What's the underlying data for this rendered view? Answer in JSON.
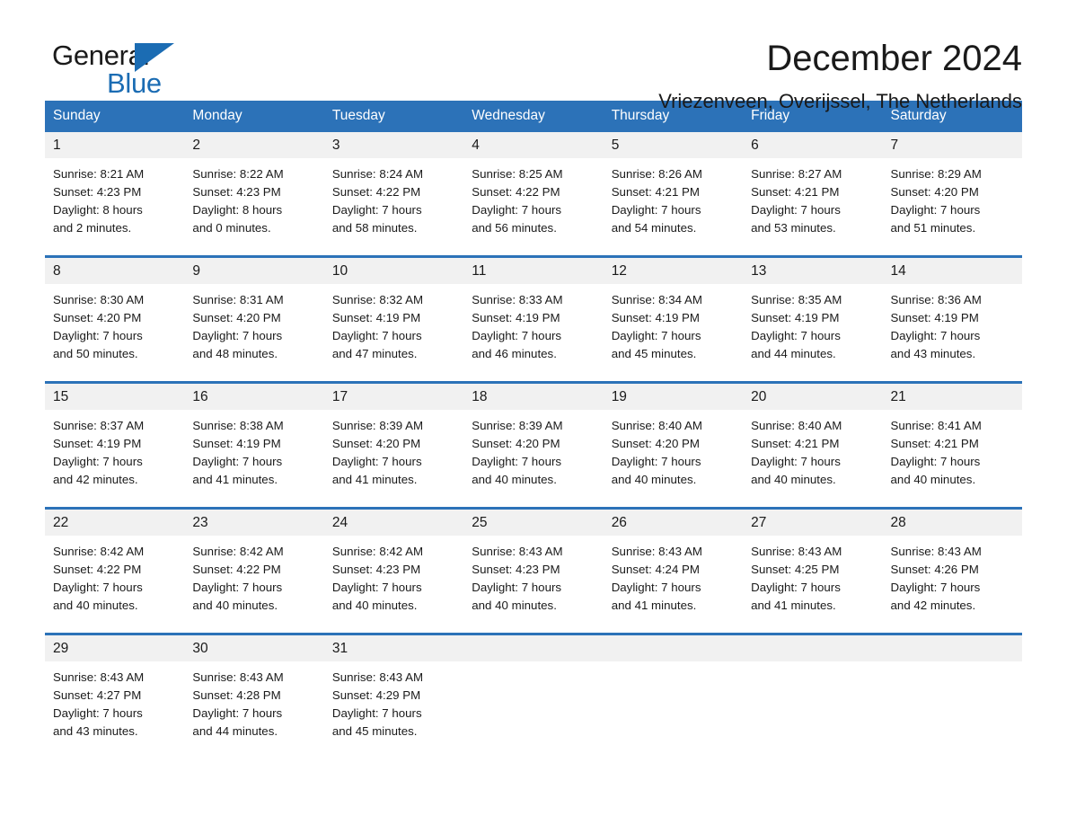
{
  "brand": {
    "name_part1": "General",
    "name_part2": "Blue",
    "flag_icon": "triangle-flag-icon",
    "accent_color": "#1b6cb3"
  },
  "header": {
    "title": "December 2024",
    "subtitle": "Vriezenveen, Overijssel, The Netherlands"
  },
  "theme": {
    "header_row_bg": "#2c72b8",
    "daynum_bg": "#f1f1f1",
    "week_divider": "#2c72b8",
    "text": "#1a1a1a"
  },
  "weekday_headers": [
    "Sunday",
    "Monday",
    "Tuesday",
    "Wednesday",
    "Thursday",
    "Friday",
    "Saturday"
  ],
  "weeks": [
    [
      {
        "day": "1",
        "sunrise": "Sunrise: 8:21 AM",
        "sunset": "Sunset: 4:23 PM",
        "daylight_line1": "Daylight: 8 hours",
        "daylight_line2": "and 2 minutes."
      },
      {
        "day": "2",
        "sunrise": "Sunrise: 8:22 AM",
        "sunset": "Sunset: 4:23 PM",
        "daylight_line1": "Daylight: 8 hours",
        "daylight_line2": "and 0 minutes."
      },
      {
        "day": "3",
        "sunrise": "Sunrise: 8:24 AM",
        "sunset": "Sunset: 4:22 PM",
        "daylight_line1": "Daylight: 7 hours",
        "daylight_line2": "and 58 minutes."
      },
      {
        "day": "4",
        "sunrise": "Sunrise: 8:25 AM",
        "sunset": "Sunset: 4:22 PM",
        "daylight_line1": "Daylight: 7 hours",
        "daylight_line2": "and 56 minutes."
      },
      {
        "day": "5",
        "sunrise": "Sunrise: 8:26 AM",
        "sunset": "Sunset: 4:21 PM",
        "daylight_line1": "Daylight: 7 hours",
        "daylight_line2": "and 54 minutes."
      },
      {
        "day": "6",
        "sunrise": "Sunrise: 8:27 AM",
        "sunset": "Sunset: 4:21 PM",
        "daylight_line1": "Daylight: 7 hours",
        "daylight_line2": "and 53 minutes."
      },
      {
        "day": "7",
        "sunrise": "Sunrise: 8:29 AM",
        "sunset": "Sunset: 4:20 PM",
        "daylight_line1": "Daylight: 7 hours",
        "daylight_line2": "and 51 minutes."
      }
    ],
    [
      {
        "day": "8",
        "sunrise": "Sunrise: 8:30 AM",
        "sunset": "Sunset: 4:20 PM",
        "daylight_line1": "Daylight: 7 hours",
        "daylight_line2": "and 50 minutes."
      },
      {
        "day": "9",
        "sunrise": "Sunrise: 8:31 AM",
        "sunset": "Sunset: 4:20 PM",
        "daylight_line1": "Daylight: 7 hours",
        "daylight_line2": "and 48 minutes."
      },
      {
        "day": "10",
        "sunrise": "Sunrise: 8:32 AM",
        "sunset": "Sunset: 4:19 PM",
        "daylight_line1": "Daylight: 7 hours",
        "daylight_line2": "and 47 minutes."
      },
      {
        "day": "11",
        "sunrise": "Sunrise: 8:33 AM",
        "sunset": "Sunset: 4:19 PM",
        "daylight_line1": "Daylight: 7 hours",
        "daylight_line2": "and 46 minutes."
      },
      {
        "day": "12",
        "sunrise": "Sunrise: 8:34 AM",
        "sunset": "Sunset: 4:19 PM",
        "daylight_line1": "Daylight: 7 hours",
        "daylight_line2": "and 45 minutes."
      },
      {
        "day": "13",
        "sunrise": "Sunrise: 8:35 AM",
        "sunset": "Sunset: 4:19 PM",
        "daylight_line1": "Daylight: 7 hours",
        "daylight_line2": "and 44 minutes."
      },
      {
        "day": "14",
        "sunrise": "Sunrise: 8:36 AM",
        "sunset": "Sunset: 4:19 PM",
        "daylight_line1": "Daylight: 7 hours",
        "daylight_line2": "and 43 minutes."
      }
    ],
    [
      {
        "day": "15",
        "sunrise": "Sunrise: 8:37 AM",
        "sunset": "Sunset: 4:19 PM",
        "daylight_line1": "Daylight: 7 hours",
        "daylight_line2": "and 42 minutes."
      },
      {
        "day": "16",
        "sunrise": "Sunrise: 8:38 AM",
        "sunset": "Sunset: 4:19 PM",
        "daylight_line1": "Daylight: 7 hours",
        "daylight_line2": "and 41 minutes."
      },
      {
        "day": "17",
        "sunrise": "Sunrise: 8:39 AM",
        "sunset": "Sunset: 4:20 PM",
        "daylight_line1": "Daylight: 7 hours",
        "daylight_line2": "and 41 minutes."
      },
      {
        "day": "18",
        "sunrise": "Sunrise: 8:39 AM",
        "sunset": "Sunset: 4:20 PM",
        "daylight_line1": "Daylight: 7 hours",
        "daylight_line2": "and 40 minutes."
      },
      {
        "day": "19",
        "sunrise": "Sunrise: 8:40 AM",
        "sunset": "Sunset: 4:20 PM",
        "daylight_line1": "Daylight: 7 hours",
        "daylight_line2": "and 40 minutes."
      },
      {
        "day": "20",
        "sunrise": "Sunrise: 8:40 AM",
        "sunset": "Sunset: 4:21 PM",
        "daylight_line1": "Daylight: 7 hours",
        "daylight_line2": "and 40 minutes."
      },
      {
        "day": "21",
        "sunrise": "Sunrise: 8:41 AM",
        "sunset": "Sunset: 4:21 PM",
        "daylight_line1": "Daylight: 7 hours",
        "daylight_line2": "and 40 minutes."
      }
    ],
    [
      {
        "day": "22",
        "sunrise": "Sunrise: 8:42 AM",
        "sunset": "Sunset: 4:22 PM",
        "daylight_line1": "Daylight: 7 hours",
        "daylight_line2": "and 40 minutes."
      },
      {
        "day": "23",
        "sunrise": "Sunrise: 8:42 AM",
        "sunset": "Sunset: 4:22 PM",
        "daylight_line1": "Daylight: 7 hours",
        "daylight_line2": "and 40 minutes."
      },
      {
        "day": "24",
        "sunrise": "Sunrise: 8:42 AM",
        "sunset": "Sunset: 4:23 PM",
        "daylight_line1": "Daylight: 7 hours",
        "daylight_line2": "and 40 minutes."
      },
      {
        "day": "25",
        "sunrise": "Sunrise: 8:43 AM",
        "sunset": "Sunset: 4:23 PM",
        "daylight_line1": "Daylight: 7 hours",
        "daylight_line2": "and 40 minutes."
      },
      {
        "day": "26",
        "sunrise": "Sunrise: 8:43 AM",
        "sunset": "Sunset: 4:24 PM",
        "daylight_line1": "Daylight: 7 hours",
        "daylight_line2": "and 41 minutes."
      },
      {
        "day": "27",
        "sunrise": "Sunrise: 8:43 AM",
        "sunset": "Sunset: 4:25 PM",
        "daylight_line1": "Daylight: 7 hours",
        "daylight_line2": "and 41 minutes."
      },
      {
        "day": "28",
        "sunrise": "Sunrise: 8:43 AM",
        "sunset": "Sunset: 4:26 PM",
        "daylight_line1": "Daylight: 7 hours",
        "daylight_line2": "and 42 minutes."
      }
    ],
    [
      {
        "day": "29",
        "sunrise": "Sunrise: 8:43 AM",
        "sunset": "Sunset: 4:27 PM",
        "daylight_line1": "Daylight: 7 hours",
        "daylight_line2": "and 43 minutes."
      },
      {
        "day": "30",
        "sunrise": "Sunrise: 8:43 AM",
        "sunset": "Sunset: 4:28 PM",
        "daylight_line1": "Daylight: 7 hours",
        "daylight_line2": "and 44 minutes."
      },
      {
        "day": "31",
        "sunrise": "Sunrise: 8:43 AM",
        "sunset": "Sunset: 4:29 PM",
        "daylight_line1": "Daylight: 7 hours",
        "daylight_line2": "and 45 minutes."
      },
      {
        "day": "",
        "sunrise": "",
        "sunset": "",
        "daylight_line1": "",
        "daylight_line2": ""
      },
      {
        "day": "",
        "sunrise": "",
        "sunset": "",
        "daylight_line1": "",
        "daylight_line2": ""
      },
      {
        "day": "",
        "sunrise": "",
        "sunset": "",
        "daylight_line1": "",
        "daylight_line2": ""
      },
      {
        "day": "",
        "sunrise": "",
        "sunset": "",
        "daylight_line1": "",
        "daylight_line2": ""
      }
    ]
  ]
}
